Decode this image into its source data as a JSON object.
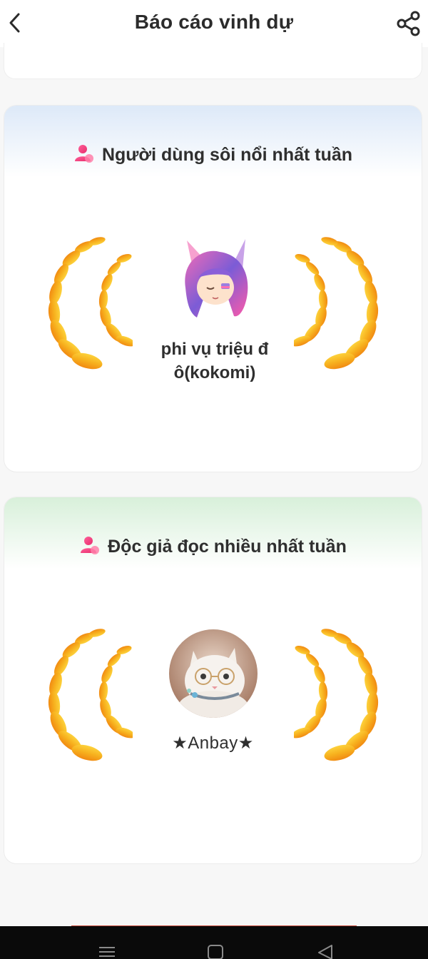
{
  "header": {
    "title": "Báo cáo vinh dự",
    "back_icon": "chevron-left-icon",
    "share_icon": "share-icon"
  },
  "cards": [
    {
      "title": "Người dùng sôi nổi nhất tuần",
      "icon": "user-icon",
      "header_color": "#dde9f8",
      "user_name": "phi vụ triệu đ ô(kokomi)",
      "avatar": "anime-avatar-icon"
    },
    {
      "title": "Độc giả đọc nhiều nhất tuần",
      "icon": "user-icon",
      "header_color": "#d8f0da",
      "user_name": "★Anbay★",
      "avatar": "cat-avatar"
    }
  ],
  "colors": {
    "laurel_gold": "#f7b81e",
    "laurel_orange": "#f3901a",
    "user_icon_pink": "#f0407a"
  },
  "system_nav": {
    "icons": [
      "menu-icon",
      "home-icon",
      "back-triangle-icon"
    ]
  }
}
